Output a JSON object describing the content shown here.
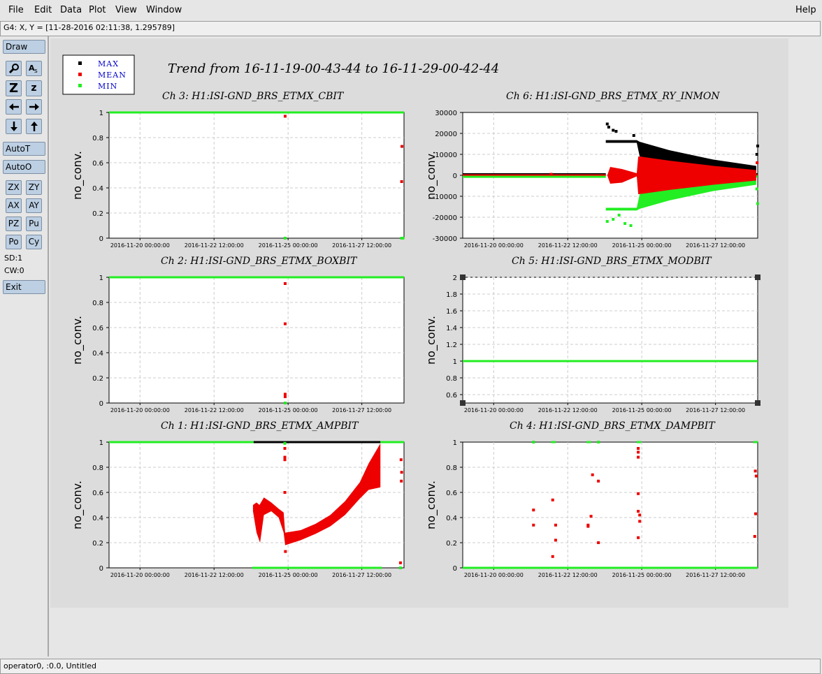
{
  "menu": {
    "file": "File",
    "edit": "Edit",
    "data": "Data",
    "plot": "Plot",
    "view": "View",
    "window": "Window",
    "help": "Help"
  },
  "coord_readout": "G4: X, Y = [11-28-2016 02:11:38, 1.295789]",
  "panel": {
    "draw": "Draw",
    "z_big": "Z",
    "z_small": "z",
    "autot": "AutoT",
    "autoo": "AutoO",
    "zx": "ZX",
    "zy": "ZY",
    "ax": "AX",
    "ay": "AY",
    "pz": "PZ",
    "pu": "Pu",
    "po": "Po",
    "cy": "Cy",
    "sd": "SD:1",
    "cw": "CW:0",
    "exit": "Exit"
  },
  "status": "operator0, :0.0, Untitled",
  "colors": {
    "max": "#000000",
    "mean": "#ee0000",
    "min": "#22ee22",
    "legend_text": "#0000cc",
    "plot_bg": "#dcdcdc"
  },
  "legend": {
    "max": "MAX",
    "mean": "MEAN",
    "min": "MIN"
  },
  "main_title": "Trend from 16-11-19-00-43-44 to 16-11-29-00-42-44",
  "chart_data": [
    {
      "type": "scatter",
      "title": "Ch 3: H1:ISI-GND_BRS_ETMX_CBIT",
      "ylabel": "no_conv.",
      "ylim": [
        0,
        1
      ],
      "yticks": [
        "0",
        "0.2",
        "0.4",
        "0.6",
        "0.8",
        "1"
      ],
      "xticks": [
        "2016-11-20 00:00:00",
        "2016-11-22 12:00:00",
        "2016-11-25 00:00:00",
        "2016-11-27 12:00:00"
      ],
      "grid": true,
      "series": [
        {
          "name": "MAX",
          "color": "black",
          "segments": [
            [
              0,
              1,
              1
            ]
          ],
          "points": []
        },
        {
          "name": "MEAN",
          "color": "red",
          "segments": [],
          "points": [
            [
              5.97,
              0.97
            ],
            [
              9.93,
              0.73
            ],
            [
              9.92,
              0.45
            ]
          ]
        },
        {
          "name": "MIN",
          "color": "green",
          "segments": [
            [
              0,
              10,
              1
            ]
          ],
          "points": [
            [
              5.97,
              0
            ],
            [
              9.92,
              0
            ],
            [
              9.96,
              0
            ]
          ]
        }
      ]
    },
    {
      "type": "scatter",
      "title": "Ch 6: H1:ISI-GND_BRS_ETMX_RY_INMON",
      "ylabel": "no_conv.",
      "ylim": [
        -30000,
        30000
      ],
      "yticks": [
        "-30000",
        "-20000",
        "-10000",
        "0",
        "10000",
        "20000",
        "30000"
      ],
      "xticks": [
        "2016-11-20 00:00:00",
        "2016-11-22 12:00:00",
        "2016-11-25 00:00:00",
        "2016-11-27 12:00:00"
      ],
      "grid": true,
      "envelopes": [
        {
          "color": "red",
          "upper": [
            [
              4.9,
              0
            ],
            [
              5.0,
              4000
            ],
            [
              5.4,
              3000
            ],
            [
              5.9,
              1000
            ],
            [
              5.95,
              9000
            ],
            [
              6.5,
              8500
            ],
            [
              8.0,
              6500
            ],
            [
              9.7,
              3500
            ],
            [
              9.95,
              3000
            ]
          ],
          "lower": [
            [
              4.9,
              0
            ],
            [
              5.0,
              -4000
            ],
            [
              5.4,
              -3500
            ],
            [
              5.9,
              -500
            ],
            [
              5.95,
              -9000
            ],
            [
              6.5,
              -8500
            ],
            [
              8.0,
              -6500
            ],
            [
              9.7,
              -3500
            ],
            [
              9.95,
              -3000
            ]
          ]
        },
        {
          "color": "black",
          "upper": [
            [
              4.85,
              16800
            ],
            [
              5.9,
              16800
            ],
            [
              6.0,
              16000
            ],
            [
              7.0,
              12000
            ],
            [
              8.5,
              7500
            ],
            [
              9.95,
              4500
            ]
          ],
          "lower": [
            [
              4.85,
              15500
            ],
            [
              5.9,
              15500
            ],
            [
              6.0,
              9000
            ],
            [
              7.0,
              7000
            ],
            [
              8.5,
              4500
            ],
            [
              9.95,
              2500
            ]
          ]
        },
        {
          "color": "green",
          "upper": [
            [
              4.85,
              -15500
            ],
            [
              5.9,
              -15500
            ],
            [
              6.0,
              -9000
            ],
            [
              7.0,
              -7000
            ],
            [
              8.5,
              -4500
            ],
            [
              9.95,
              -2500
            ]
          ],
          "lower": [
            [
              4.85,
              -16800
            ],
            [
              5.9,
              -16800
            ],
            [
              6.0,
              -16000
            ],
            [
              7.0,
              -12000
            ],
            [
              8.5,
              -7500
            ],
            [
              9.95,
              -4500
            ]
          ]
        }
      ],
      "series": [
        {
          "name": "MAX",
          "color": "black",
          "segments": [
            [
              0,
              4.85,
              500
            ],
            [
              9.95,
              10,
              500
            ]
          ],
          "points": [
            [
              4.9,
              24500
            ],
            [
              4.95,
              23000
            ],
            [
              5.1,
              21500
            ],
            [
              5.2,
              21000
            ],
            [
              5.8,
              19000
            ],
            [
              10.0,
              14000
            ],
            [
              9.97,
              10000
            ]
          ]
        },
        {
          "name": "MEAN",
          "color": "red",
          "segments": [
            [
              0,
              4.85,
              0
            ],
            [
              9.95,
              10,
              0
            ]
          ],
          "points": [
            [
              3.0,
              500
            ],
            [
              9.98,
              6000
            ]
          ]
        },
        {
          "name": "MIN",
          "color": "green",
          "segments": [
            [
              0,
              4.85,
              -700
            ],
            [
              9.95,
              10,
              -600
            ]
          ],
          "points": [
            [
              4.9,
              -22000
            ],
            [
              5.1,
              -21000
            ],
            [
              5.3,
              -19000
            ],
            [
              5.5,
              -23000
            ],
            [
              5.7,
              -24000
            ],
            [
              10.0,
              -13500
            ],
            [
              9.97,
              -6500
            ]
          ]
        }
      ]
    },
    {
      "type": "scatter",
      "title": "Ch 2: H1:ISI-GND_BRS_ETMX_BOXBIT",
      "ylabel": "no_conv.",
      "ylim": [
        0,
        1
      ],
      "yticks": [
        "0",
        "0.2",
        "0.4",
        "0.6",
        "0.8",
        "1"
      ],
      "xticks": [
        "2016-11-20 00:00:00",
        "2016-11-22 12:00:00",
        "2016-11-25 00:00:00",
        "2016-11-27 12:00:00"
      ],
      "grid": true,
      "series": [
        {
          "name": "MAX",
          "color": "black",
          "segments": [
            [
              0,
              10,
              1
            ]
          ],
          "points": []
        },
        {
          "name": "MEAN",
          "color": "red",
          "segments": [],
          "points": [
            [
              5.97,
              0.95
            ],
            [
              5.97,
              0.63
            ],
            [
              5.97,
              0.07
            ],
            [
              5.97,
              0.05
            ]
          ]
        },
        {
          "name": "MIN",
          "color": "green",
          "segments": [
            [
              0,
              10,
              1
            ]
          ],
          "points": [
            [
              5.97,
              0
            ]
          ]
        }
      ]
    },
    {
      "type": "line",
      "title": "Ch 5: H1:ISI-GND_BRS_ETMX_MODBIT",
      "ylabel": "no_conv.",
      "ylim": [
        0.5,
        2
      ],
      "yticks": [
        "0.6",
        "0.8",
        "1",
        "1.2",
        "1.4",
        "1.6",
        "1.8",
        "2"
      ],
      "xticks": [
        "2016-11-20 00:00:00",
        "2016-11-22 12:00:00",
        "2016-11-25 00:00:00",
        "2016-11-27 12:00:00"
      ],
      "grid": true,
      "series": [
        {
          "name": "MAX",
          "color": "black",
          "segments": [
            [
              0,
              10,
              1
            ]
          ],
          "points": []
        },
        {
          "name": "MEAN",
          "color": "red",
          "segments": [
            [
              0,
              10,
              1
            ]
          ],
          "points": []
        },
        {
          "name": "MIN",
          "color": "green",
          "segments": [
            [
              0,
              10,
              1
            ]
          ],
          "points": []
        }
      ]
    },
    {
      "type": "scatter",
      "title": "Ch 1: H1:ISI-GND_BRS_ETMX_AMPBIT",
      "ylabel": "no_conv.",
      "ylim": [
        0,
        1
      ],
      "yticks": [
        "0",
        "0.2",
        "0.4",
        "0.6",
        "0.8",
        "1"
      ],
      "xticks": [
        "2016-11-20 00:00:00",
        "2016-11-22 12:00:00",
        "2016-11-25 00:00:00",
        "2016-11-27 12:00:00"
      ],
      "grid": true,
      "envelopes": [
        {
          "color": "red",
          "upper": [
            [
              4.88,
              0.5
            ],
            [
              5.0,
              0.52
            ],
            [
              5.1,
              0.5
            ],
            [
              5.25,
              0.56
            ],
            [
              5.5,
              0.52
            ],
            [
              5.75,
              0.47
            ],
            [
              5.92,
              0.44
            ],
            [
              5.97,
              0.28
            ],
            [
              6.5,
              0.3
            ],
            [
              7.0,
              0.35
            ],
            [
              7.5,
              0.42
            ],
            [
              8.0,
              0.53
            ],
            [
              8.5,
              0.68
            ],
            [
              8.8,
              0.83
            ],
            [
              9.2,
              0.99
            ]
          ],
          "lower": [
            [
              4.88,
              0.45
            ],
            [
              5.0,
              0.28
            ],
            [
              5.12,
              0.2
            ],
            [
              5.25,
              0.42
            ],
            [
              5.5,
              0.45
            ],
            [
              5.75,
              0.4
            ],
            [
              5.92,
              0.28
            ],
            [
              5.97,
              0.18
            ],
            [
              6.5,
              0.22
            ],
            [
              7.0,
              0.27
            ],
            [
              7.5,
              0.33
            ],
            [
              8.0,
              0.42
            ],
            [
              8.5,
              0.55
            ],
            [
              8.8,
              0.62
            ],
            [
              9.2,
              0.64
            ]
          ]
        }
      ],
      "series": [
        {
          "name": "MAX",
          "color": "black",
          "segments": [
            [
              4.9,
              9.2,
              1
            ]
          ],
          "points": []
        },
        {
          "name": "MEAN",
          "color": "red",
          "segments": [],
          "points": [
            [
              5.96,
              0.95
            ],
            [
              5.96,
              0.88
            ],
            [
              5.96,
              0.86
            ],
            [
              5.96,
              0.6
            ],
            [
              5.98,
              0.13
            ],
            [
              9.9,
              0.86
            ],
            [
              9.92,
              0.76
            ],
            [
              9.91,
              0.69
            ],
            [
              9.88,
              0.04
            ]
          ]
        },
        {
          "name": "MIN",
          "color": "green",
          "segments": [
            [
              0,
              4.9,
              1
            ],
            [
              9.2,
              10,
              1
            ],
            [
              4.85,
              9.25,
              0
            ]
          ],
          "points": [
            [
              5.96,
              0.99
            ],
            [
              9.88,
              0
            ]
          ]
        }
      ]
    },
    {
      "type": "scatter",
      "title": "Ch 4: H1:ISI-GND_BRS_ETMX_DAMPBIT",
      "ylabel": "no_conv.",
      "ylim": [
        0,
        1
      ],
      "yticks": [
        "0",
        "0.2",
        "0.4",
        "0.6",
        "0.8",
        "1"
      ],
      "xticks": [
        "2016-11-20 00:00:00",
        "2016-11-22 12:00:00",
        "2016-11-25 00:00:00",
        "2016-11-27 12:00:00"
      ],
      "grid": true,
      "series": [
        {
          "name": "MAX",
          "color": "black",
          "segments": [
            [
              0,
              10,
              0
            ]
          ],
          "points": []
        },
        {
          "name": "MEAN",
          "color": "red",
          "segments": [],
          "points": [
            [
              2.4,
              0.46
            ],
            [
              2.4,
              0.34
            ],
            [
              3.05,
              0.54
            ],
            [
              3.05,
              0.09
            ],
            [
              3.15,
              0.34
            ],
            [
              3.15,
              0.22
            ],
            [
              4.25,
              0.34
            ],
            [
              4.25,
              0.33
            ],
            [
              4.4,
              0.74
            ],
            [
              4.35,
              0.41
            ],
            [
              4.6,
              0.69
            ],
            [
              4.6,
              0.2
            ],
            [
              5.95,
              0.95
            ],
            [
              5.95,
              0.92
            ],
            [
              5.95,
              0.88
            ],
            [
              5.95,
              0.59
            ],
            [
              5.95,
              0.45
            ],
            [
              5.95,
              0.24
            ],
            [
              6.0,
              0.42
            ],
            [
              6.0,
              0.37
            ],
            [
              9.92,
              0.77
            ],
            [
              9.95,
              0.73
            ],
            [
              9.93,
              0.43
            ],
            [
              9.9,
              0.25
            ]
          ]
        },
        {
          "name": "MIN",
          "color": "green",
          "segments": [
            [
              0,
              10,
              0
            ],
            [
              3.0,
              3.15,
              1
            ],
            [
              4.2,
              4.35,
              1
            ],
            [
              5.9,
              6.05,
              1
            ],
            [
              9.85,
              10,
              1
            ]
          ],
          "points": [
            [
              2.4,
              1
            ],
            [
              4.6,
              1
            ]
          ]
        }
      ]
    }
  ]
}
